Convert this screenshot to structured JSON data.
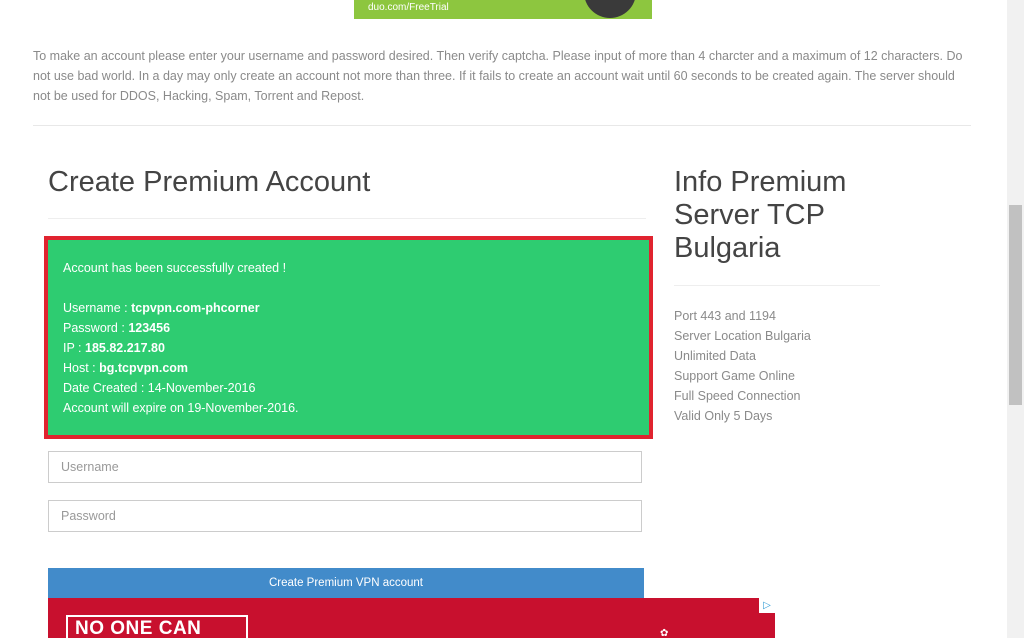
{
  "top_ad": {
    "url_text": "duo.com/FreeTrial"
  },
  "intro_text": "To make an account please enter your username and password desired. Then verify captcha. Please input of more than 4 charcter and a maximum of 12 characters. Do not use bad world. In a day may only create an account not more than three. If it fails to create an account wait until 60 seconds to be created again. The server should not be used for DDOS, Hacking, Spam, Torrent and Repost.",
  "main": {
    "title": "Create Premium Account",
    "success": {
      "message": "Account has been successfully created !",
      "username_label": "Username : ",
      "username_value": "tcpvpn.com-phcorner",
      "password_label": "Password : ",
      "password_value": "123456",
      "ip_label": "IP : ",
      "ip_value": "185.82.217.80",
      "host_label": "Host : ",
      "host_value": "bg.tcpvpn.com",
      "date_created": "Date Created : 14-November-2016",
      "expire": "Account will expire on 19-November-2016."
    },
    "username_placeholder": "Username",
    "password_placeholder": "Password",
    "submit_label": "Create Premium VPN account"
  },
  "bottom_ad": {
    "text": "NO ONE CAN"
  },
  "sidebar": {
    "title": "Info Premium Server TCP Bulgaria",
    "items": [
      "Port 443 and 1194",
      "Server Location Bulgaria",
      "Unlimited Data",
      "Support Game Online",
      "Full Speed Connection",
      "Valid Only 5 Days"
    ]
  }
}
